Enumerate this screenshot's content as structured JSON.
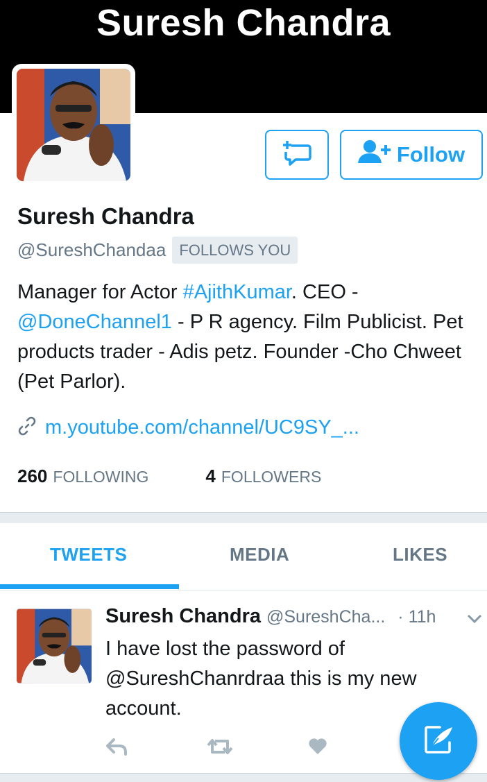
{
  "header": {
    "title": "Suresh Chandra"
  },
  "profile": {
    "name": "Suresh Chandra",
    "handle": "@SureshChandaa",
    "follows_you_badge": "FOLLOWS YOU",
    "bio": {
      "part1": "Manager for Actor ",
      "hashtag": "#AjithKumar",
      "part2": ". CEO - ",
      "mention": "@DoneChannel1",
      "part3": " - P R agency. Film Publicist. Pet products trader - Adis petz. Founder -Cho Chweet (Pet Parlor)."
    },
    "url": "m.youtube.com/channel/UC9SY_...",
    "stats": {
      "following_count": "260",
      "following_label": "FOLLOWING",
      "followers_count": "4",
      "followers_label": "FOLLOWERS"
    }
  },
  "buttons": {
    "message_icon": "message-plus-icon",
    "follow_label": "Follow",
    "follow_icon": "add-user-icon"
  },
  "tabs": [
    {
      "label": "TWEETS",
      "active": true
    },
    {
      "label": "MEDIA",
      "active": false
    },
    {
      "label": "LIKES",
      "active": false
    }
  ],
  "tweet": {
    "name": "Suresh Chandra",
    "handle": "@SureshCha...",
    "time": "· 11h",
    "text": "I have lost the password of @SureshChanrdraa this is my new account."
  },
  "colors": {
    "accent": "#1da1f2",
    "muted": "#657786",
    "text": "#14171a",
    "header_bg": "#000000",
    "separator": "#e6ecf0"
  },
  "fab": {
    "icon": "compose-tweet-icon"
  }
}
